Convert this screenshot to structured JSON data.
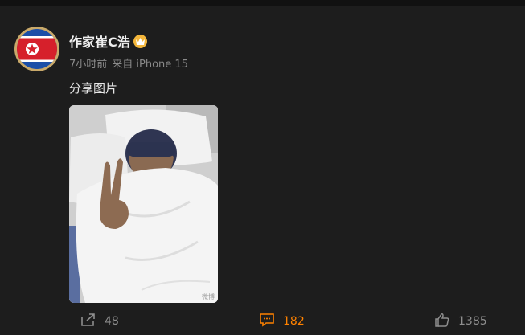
{
  "post": {
    "author": "作家崔C浩",
    "time": "7小时前",
    "source": "来自 iPhone 15",
    "text": "分享图片",
    "image_watermark": "微博"
  },
  "actions": {
    "share_count": "48",
    "comment_count": "182",
    "like_count": "1385"
  },
  "colors": {
    "background": "#1d1d1d",
    "accent": "#ff8200",
    "badge": "#f3b63b"
  }
}
